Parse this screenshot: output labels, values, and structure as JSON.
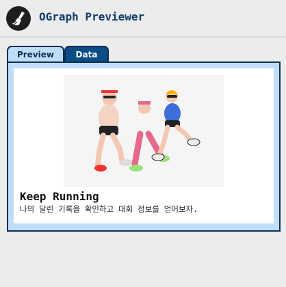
{
  "app": {
    "title": "OGraph Previewer",
    "logo_icon": "broom-icon"
  },
  "tabs": [
    {
      "label": "Preview",
      "active": true
    },
    {
      "label": "Data",
      "active": false
    }
  ],
  "preview": {
    "title": "Keep Running",
    "description": "나의 달린 기록을 확인하고 대회 정보를 얻어보자.",
    "image_subject": "three runners illustration"
  },
  "colors": {
    "brand": "#0f3d6e",
    "tab_active_bg": "#bfddf7",
    "tab_inactive_bg": "#0c4d86",
    "panel_border": "#0c2f55"
  }
}
